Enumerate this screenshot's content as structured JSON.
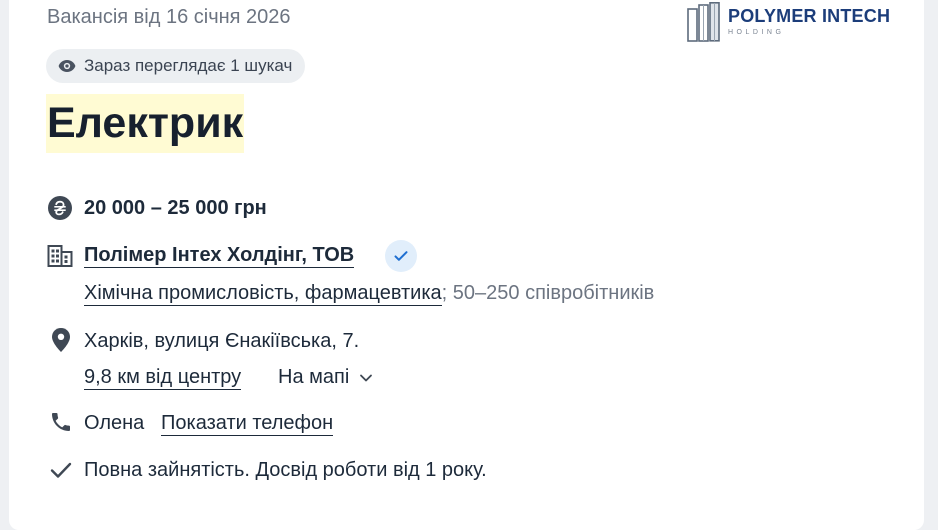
{
  "posted": "Вакансія від 16 січня 2026",
  "logo": {
    "name": "POLYMER INTECH",
    "sub": "HOLDING"
  },
  "viewers": "Зараз переглядає 1 шукач",
  "title": "Електрик",
  "salary": "20 000 – 25 000 грн",
  "company": {
    "name": "Полімер Інтех Холдінг, ТОВ",
    "industry": "Хімічна промисловість, фармацевтика",
    "size": "; 50–250 співробітників"
  },
  "location": {
    "address": "Харків, вулиця Єнакіївська, 7.",
    "distance": "9,8 км від центру",
    "map": "На мапі"
  },
  "contact": {
    "name": "Олена",
    "phone_link": "Показати телефон"
  },
  "employment": "Повна зайнятість. Досвід роботи від 1 року."
}
